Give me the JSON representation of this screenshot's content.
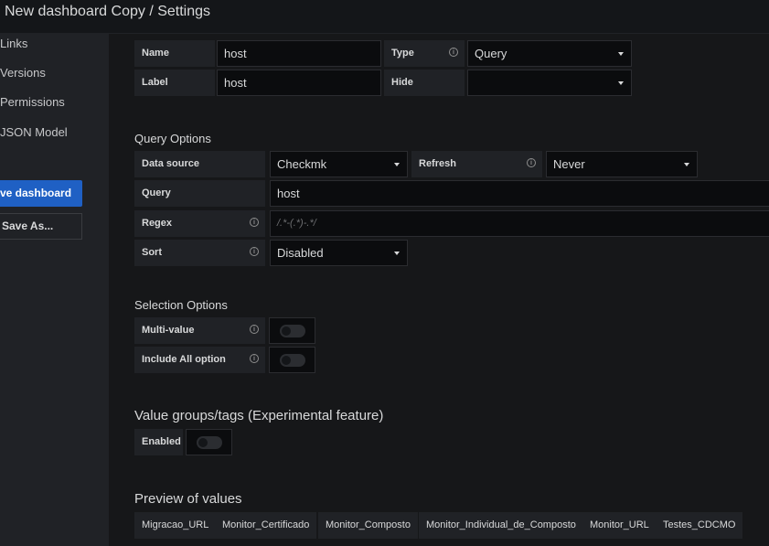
{
  "header": {
    "title": "New dashboard Copy / Settings"
  },
  "sidebar": {
    "items": [
      {
        "label": "Links"
      },
      {
        "label": "Versions"
      },
      {
        "label": "Permissions"
      },
      {
        "label": "JSON Model"
      }
    ],
    "save_button": "ve dashboard",
    "save_as_button": "Save As..."
  },
  "general": {
    "name_label": "Name",
    "name_value": "host",
    "type_label": "Type",
    "type_value": "Query",
    "label_label": "Label",
    "label_value": "host",
    "hide_label": "Hide",
    "hide_value": ""
  },
  "query_options": {
    "title": "Query Options",
    "datasource_label": "Data source",
    "datasource_value": "Checkmk",
    "refresh_label": "Refresh",
    "refresh_value": "Never",
    "query_label": "Query",
    "query_value": "host",
    "regex_label": "Regex",
    "regex_placeholder": "/.*-(.*)-.*/",
    "sort_label": "Sort",
    "sort_value": "Disabled"
  },
  "selection_options": {
    "title": "Selection Options",
    "multi_label": "Multi-value",
    "multi_enabled": false,
    "include_all_label": "Include All option",
    "include_all_enabled": false
  },
  "value_groups": {
    "title": "Value groups/tags (Experimental feature)",
    "enabled_label": "Enabled",
    "enabled": false
  },
  "preview": {
    "title": "Preview of values",
    "values": [
      "Migracao_URL",
      "Monitor_Certificado",
      "Monitor_Composto",
      "Monitor_Individual_de_Composto",
      "Monitor_URL",
      "Testes_CDCMO"
    ]
  }
}
